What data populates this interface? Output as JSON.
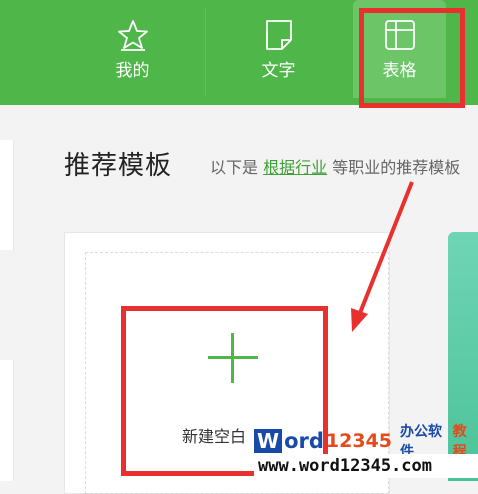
{
  "tabs": [
    {
      "label": "我的",
      "icon": "star-icon"
    },
    {
      "label": "文字",
      "icon": "document-icon"
    },
    {
      "label": "表格",
      "icon": "table-icon"
    }
  ],
  "section": {
    "title": "推荐模板",
    "subtitle_prefix": "以下是",
    "subtitle_link": "根据行业",
    "subtitle_suffix": "等职业的推荐模板"
  },
  "new_blank": {
    "label": "新建空白"
  },
  "watermark": {
    "w": "W",
    "ord": "ord",
    "num": "12345",
    "cn_a": "办公软件",
    "cn_b": "教程",
    "url": "www.word12345.com"
  },
  "colors": {
    "accent": "#4fb649",
    "highlight": "#e8312f"
  }
}
